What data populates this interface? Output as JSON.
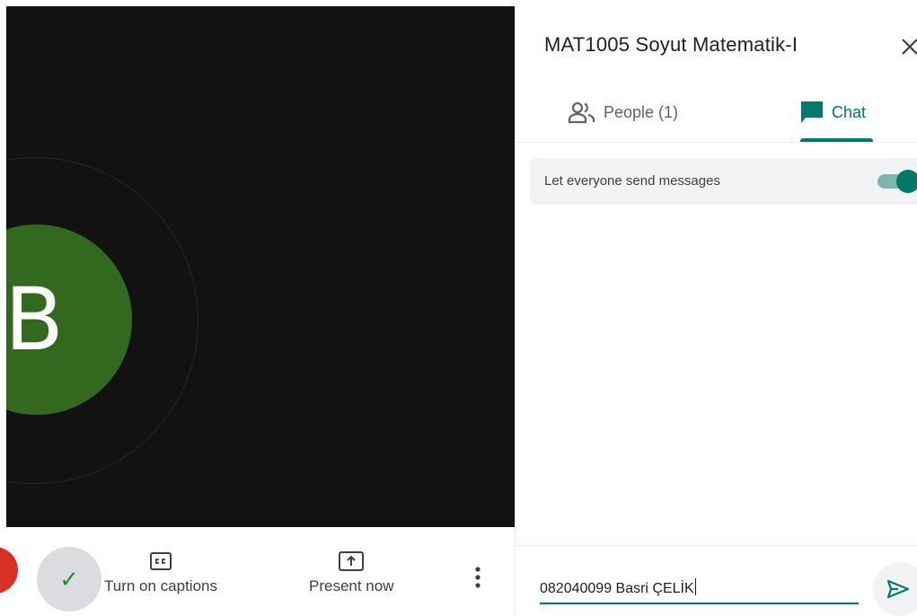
{
  "video": {
    "participant_initial": "B",
    "avatar_color": "#33691e"
  },
  "controls": {
    "captions_label": "Turn on captions",
    "present_label": "Present now",
    "check_glyph": "✓",
    "icons": [
      "end-call-icon",
      "check-icon",
      "captions-icon",
      "present-icon",
      "more-vert-icon"
    ]
  },
  "panel": {
    "title": "MAT1005 Soyut Matematik-I",
    "tabs": [
      {
        "label": "People (1)",
        "icon": "people-icon",
        "active": false
      },
      {
        "label": "Chat",
        "icon": "chat-icon",
        "active": true
      }
    ],
    "setting": {
      "label": "Let everyone send messages",
      "enabled": true
    },
    "message_input": {
      "value": "082040099 Basri ÇELİK"
    }
  },
  "colors": {
    "accent": "#00796b",
    "end_call": "#d93025",
    "video_bg": "#121212"
  }
}
